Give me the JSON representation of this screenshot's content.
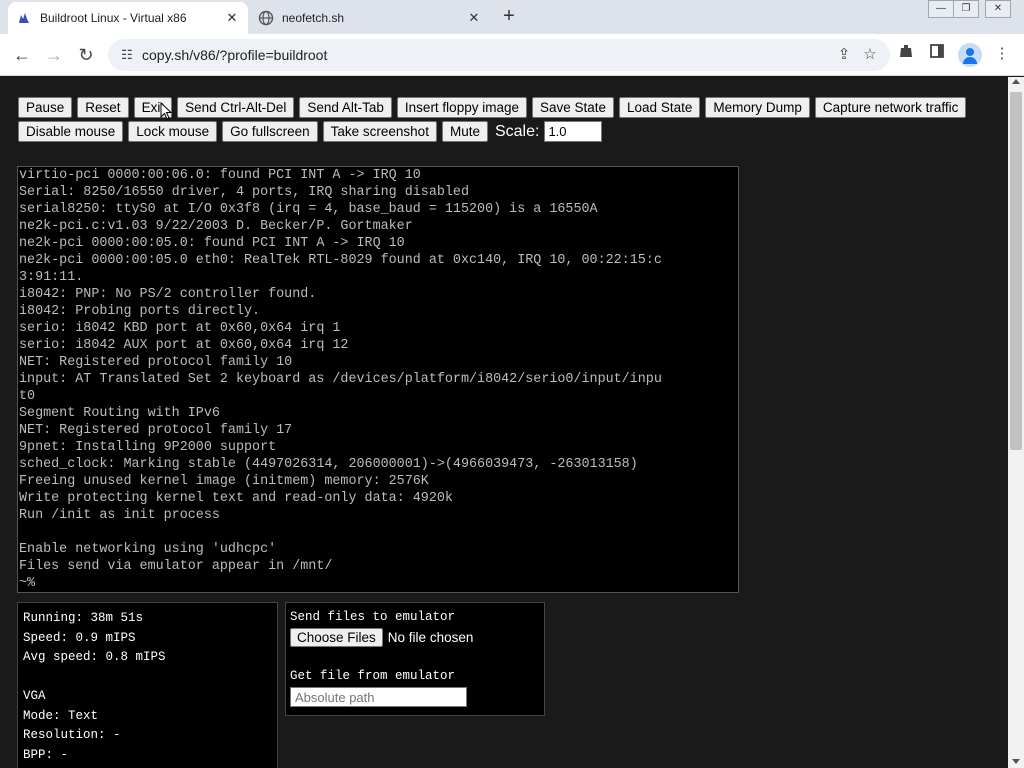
{
  "browser": {
    "tabs": [
      {
        "title": "Buildroot Linux - Virtual x86",
        "icon": "v86-icon",
        "active": true
      },
      {
        "title": "neofetch.sh",
        "icon": "globe-icon",
        "active": false
      }
    ],
    "new_tab": "+",
    "url": "copy.sh/v86/?profile=buildroot"
  },
  "controls": {
    "row1": [
      "Pause",
      "Reset",
      "Exit",
      "Send Ctrl-Alt-Del",
      "Send Alt-Tab",
      "Insert floppy image",
      "Save State",
      "Load State",
      "Memory Dump",
      "Capture network traffic"
    ],
    "row2": [
      "Disable mouse",
      "Lock mouse",
      "Go fullscreen",
      "Take screenshot",
      "Mute"
    ],
    "scale_label": "Scale:",
    "scale_value": "1.0"
  },
  "terminal": {
    "lines": [
      "virtio-pci 0000:00:06.0: found PCI INT A -> IRQ 10",
      "Serial: 8250/16550 driver, 4 ports, IRQ sharing disabled",
      "serial8250: ttyS0 at I/O 0x3f8 (irq = 4, base_baud = 115200) is a 16550A",
      "ne2k-pci.c:v1.03 9/22/2003 D. Becker/P. Gortmaker",
      "ne2k-pci 0000:00:05.0: found PCI INT A -> IRQ 10",
      "ne2k-pci 0000:00:05.0 eth0: RealTek RTL-8029 found at 0xc140, IRQ 10, 00:22:15:c",
      "3:91:11.",
      "i8042: PNP: No PS/2 controller found.",
      "i8042: Probing ports directly.",
      "serio: i8042 KBD port at 0x60,0x64 irq 1",
      "serio: i8042 AUX port at 0x60,0x64 irq 12",
      "NET: Registered protocol family 10",
      "input: AT Translated Set 2 keyboard as /devices/platform/i8042/serio0/input/inpu",
      "t0",
      "Segment Routing with IPv6",
      "NET: Registered protocol family 17",
      "9pnet: Installing 9P2000 support",
      "sched_clock: Marking stable (4497026314, 206000001)->(4966039473, -263013158)",
      "Freeing unused kernel image (initmem) memory: 2576K",
      "Write protecting kernel text and read-only data: 4920k",
      "Run /init as init process",
      "",
      "Enable networking using 'udhcpc'",
      "Files send via emulator appear in /mnt/",
      "~%"
    ]
  },
  "stats": {
    "lines": [
      "Running: 38m 51s",
      "Speed: 0.9 mIPS",
      "Avg speed: 0.8 mIPS",
      "",
      "VGA",
      "Mode: Text",
      "Resolution: -",
      "BPP: -"
    ]
  },
  "files": {
    "send_heading": "Send files to emulator",
    "choose_label": "Choose Files",
    "no_file": "No file chosen",
    "get_heading": "Get file from emulator",
    "path_placeholder": "Absolute path"
  }
}
